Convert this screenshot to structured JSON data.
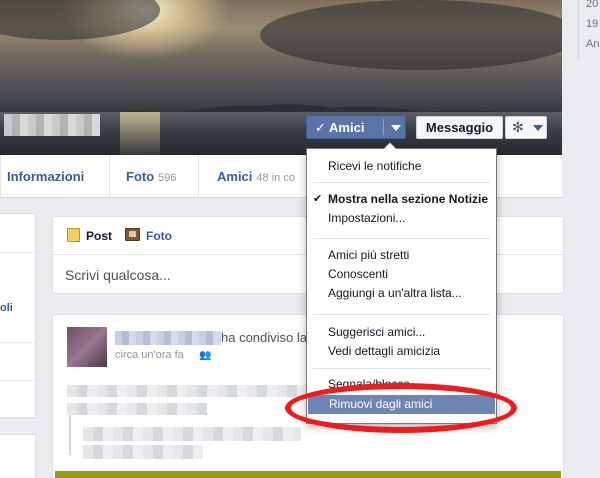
{
  "cover": {
    "profile_name": "",
    "buttons": {
      "friends": "Amici",
      "message": "Messaggio"
    }
  },
  "right_strip": {
    "items": [
      "20",
      "19",
      "An"
    ]
  },
  "tabs": [
    {
      "label": "Informazioni",
      "count": ""
    },
    {
      "label": "Foto",
      "count": "596"
    },
    {
      "label": "Amici",
      "count": "48 in co"
    }
  ],
  "left_column": {
    "link_text": "oli"
  },
  "composer": {
    "tabs": [
      "Post",
      "Foto"
    ],
    "placeholder": "Scrivi qualcosa..."
  },
  "story": {
    "action": "ha condiviso la",
    "time": "circa un'ora fa"
  },
  "friend_menu": {
    "items": [
      "Ricevi le notifiche",
      "Mostra nella sezione Notizie",
      "Impostazioni...",
      "Amici più stretti",
      "Conoscenti",
      "Aggiungi a un'altra lista...",
      "Suggerisci amici...",
      "Vedi dettagli amicizia",
      "Segnala/blocca...",
      "Rimuovi dagli amici"
    ],
    "checked_item": "Mostra nella sezione Notizie",
    "highlighted_item": "Rimuovi dagli amici"
  },
  "colors": {
    "brand_blue": "#3b5998",
    "menu_highlight": "#6d84b4",
    "annotation_red": "#ee1c1c"
  }
}
